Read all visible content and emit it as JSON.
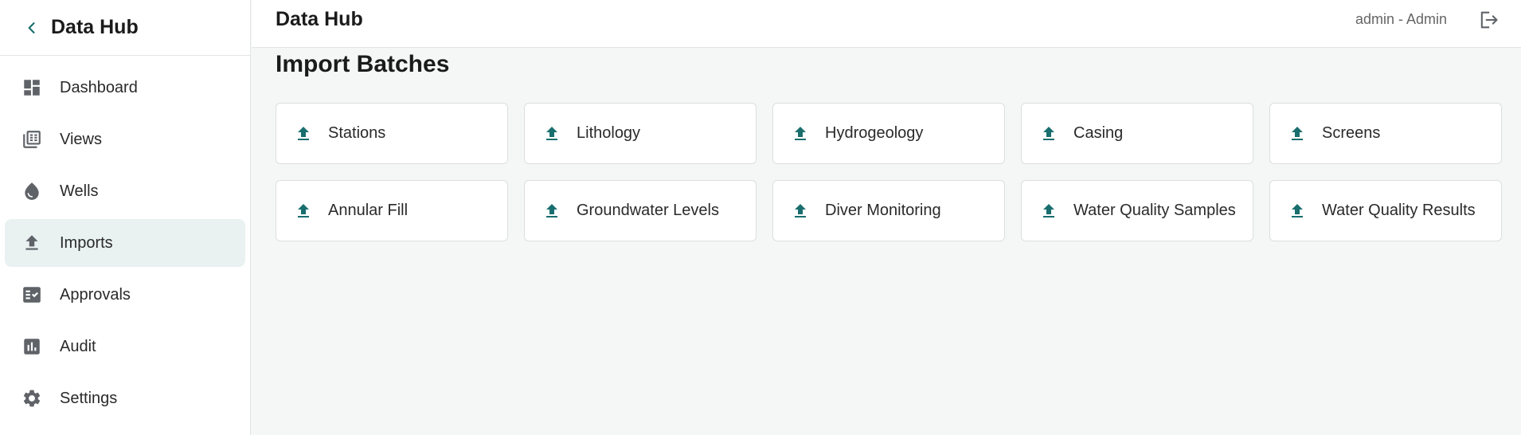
{
  "sidebar": {
    "title": "Data Hub",
    "items": [
      {
        "label": "Dashboard",
        "icon": "dashboard-icon"
      },
      {
        "label": "Views",
        "icon": "table-view-icon"
      },
      {
        "label": "Wells",
        "icon": "water-drop-icon"
      },
      {
        "label": "Imports",
        "icon": "upload-icon",
        "active": true
      },
      {
        "label": "Approvals",
        "icon": "approval-checklist-icon"
      },
      {
        "label": "Audit",
        "icon": "bar-chart-icon"
      },
      {
        "label": "Settings",
        "icon": "gear-icon"
      }
    ]
  },
  "header": {
    "title": "Data Hub",
    "user": "admin - Admin"
  },
  "main": {
    "title": "Import Batches",
    "cards": [
      {
        "label": "Stations"
      },
      {
        "label": "Lithology"
      },
      {
        "label": "Hydrogeology"
      },
      {
        "label": "Casing"
      },
      {
        "label": "Screens"
      },
      {
        "label": "Annular Fill"
      },
      {
        "label": "Groundwater Levels"
      },
      {
        "label": "Diver Monitoring"
      },
      {
        "label": "Water Quality Samples"
      },
      {
        "label": "Water Quality Results"
      }
    ]
  },
  "colors": {
    "accent": "#1a6e6e",
    "icon_gray": "#5f6368",
    "active_bg": "#e9f1f1"
  }
}
